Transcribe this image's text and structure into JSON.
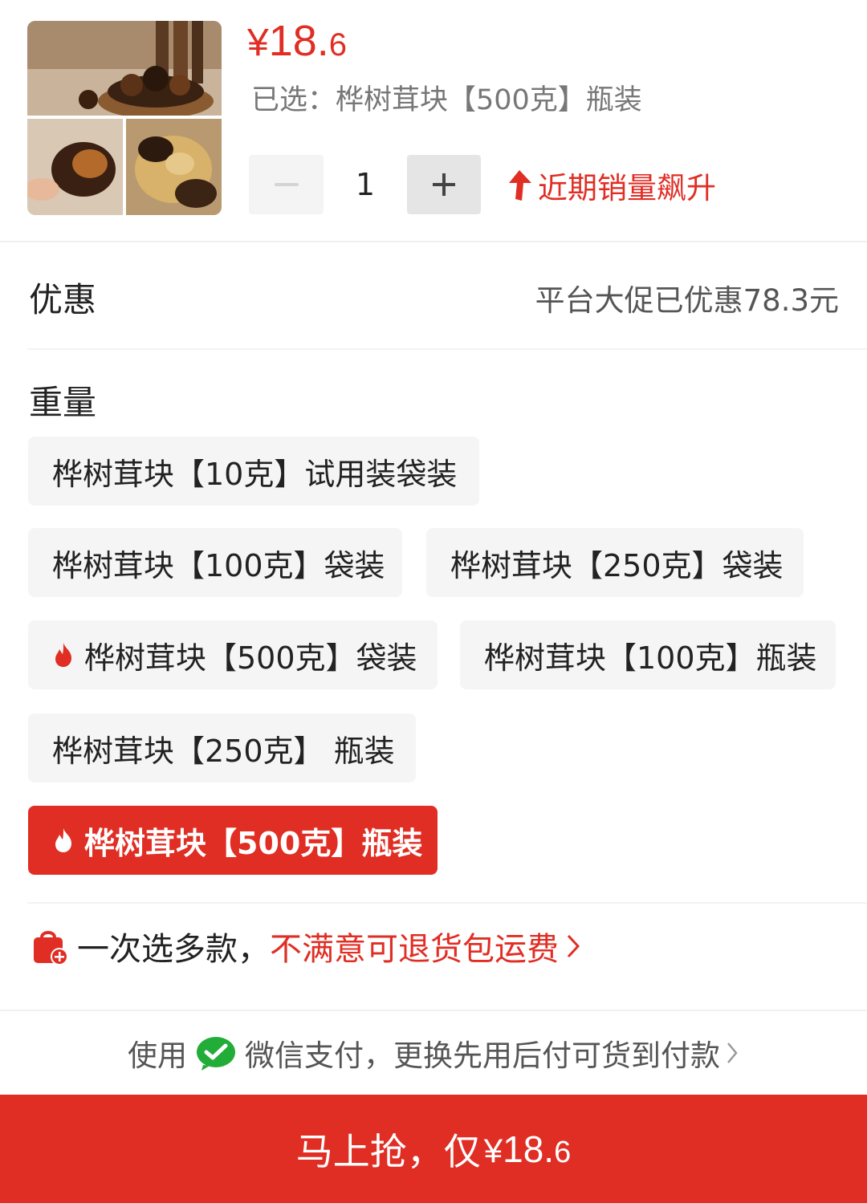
{
  "product": {
    "price_currency": "¥",
    "price_integer": "18.",
    "price_decimal": "6",
    "selected_text": "已选：桦树茸块【500克】瓶装",
    "image_icon": "product-thumbnail"
  },
  "quantity": {
    "value": "1",
    "minus_icon": "minus-icon",
    "plus_icon": "plus-icon"
  },
  "trend": {
    "label": "近期销量飙升",
    "icon": "arrow-up-icon"
  },
  "discount": {
    "label": "优惠",
    "value": "平台大促已优惠78.3元"
  },
  "weight": {
    "title": "重量",
    "options": [
      {
        "label": "桦树茸块【10克】试用装袋装",
        "hot": false,
        "selected": false
      },
      {
        "label": "桦树茸块【100克】袋装",
        "hot": false,
        "selected": false
      },
      {
        "label": "桦树茸块【250克】袋装",
        "hot": false,
        "selected": false
      },
      {
        "label": "桦树茸块【500克】袋装",
        "hot": true,
        "selected": false
      },
      {
        "label": "桦树茸块【100克】瓶装",
        "hot": false,
        "selected": false
      },
      {
        "label": "桦树茸块【250克】 瓶装",
        "hot": false,
        "selected": false
      },
      {
        "label": "桦树茸块【500克】瓶装",
        "hot": true,
        "selected": true
      }
    ]
  },
  "promo": {
    "icon": "shopping-bag-add-icon",
    "text_black": "一次选多款，",
    "text_red": "不满意可退货包运费"
  },
  "payment": {
    "prefix": "使用",
    "icon": "wechat-pay-icon",
    "text": "微信支付，更换先用后付可货到付款"
  },
  "buy_button": {
    "label": "马上抢，仅 ",
    "currency": "¥",
    "integer": "18.",
    "decimal": "6"
  },
  "colors": {
    "accent": "#e02e24",
    "option_bg": "#f5f5f5",
    "muted_text": "#777777"
  }
}
